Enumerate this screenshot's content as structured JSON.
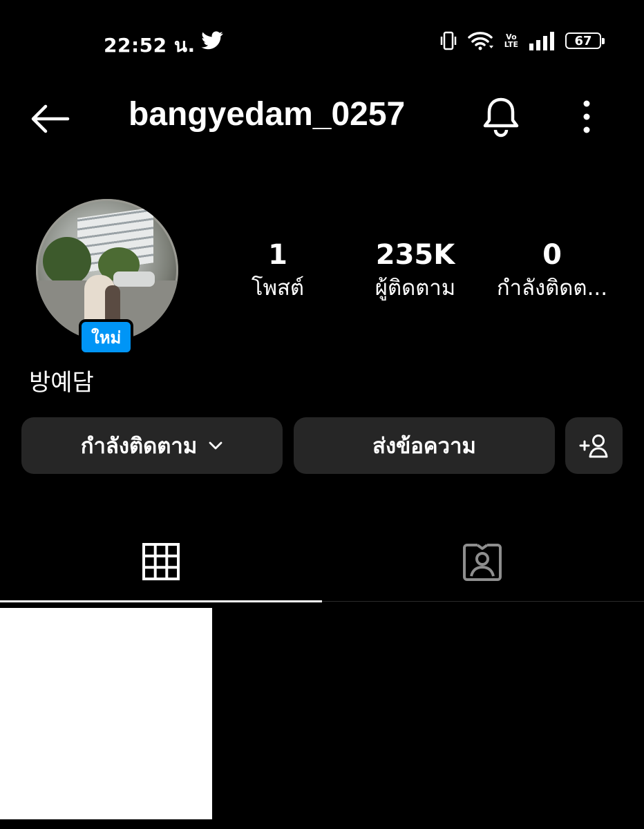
{
  "status_bar": {
    "time": "22:52 น.",
    "battery": "67",
    "volte_top": "Vo",
    "volte_bottom": "LTE",
    "icons": [
      "twitter-icon",
      "vibrate-icon",
      "wifi-icon",
      "volte-icon",
      "signal-icon",
      "battery-icon"
    ]
  },
  "header": {
    "username": "bangyedam_0257",
    "icons": [
      "back-arrow-icon",
      "bell-icon",
      "more-vertical-icon"
    ]
  },
  "profile": {
    "new_badge": "ใหม่",
    "display_name": "방예담",
    "stats": [
      {
        "value": "1",
        "label": "โพสต์"
      },
      {
        "value": "235K",
        "label": "ผู้ติดตาม"
      },
      {
        "value": "0",
        "label": "กำลังติดต..."
      }
    ]
  },
  "actions": {
    "following_label": "กำลังติดตาม",
    "message_label": "ส่งข้อความ",
    "icons": [
      "chevron-down-icon",
      "add-person-icon"
    ]
  },
  "tabs": {
    "icons": [
      "grid-icon",
      "tagged-icon"
    ],
    "active": 0
  },
  "colors": {
    "background": "#000000",
    "button_bg": "#262626",
    "badge_blue": "#0095f6"
  }
}
